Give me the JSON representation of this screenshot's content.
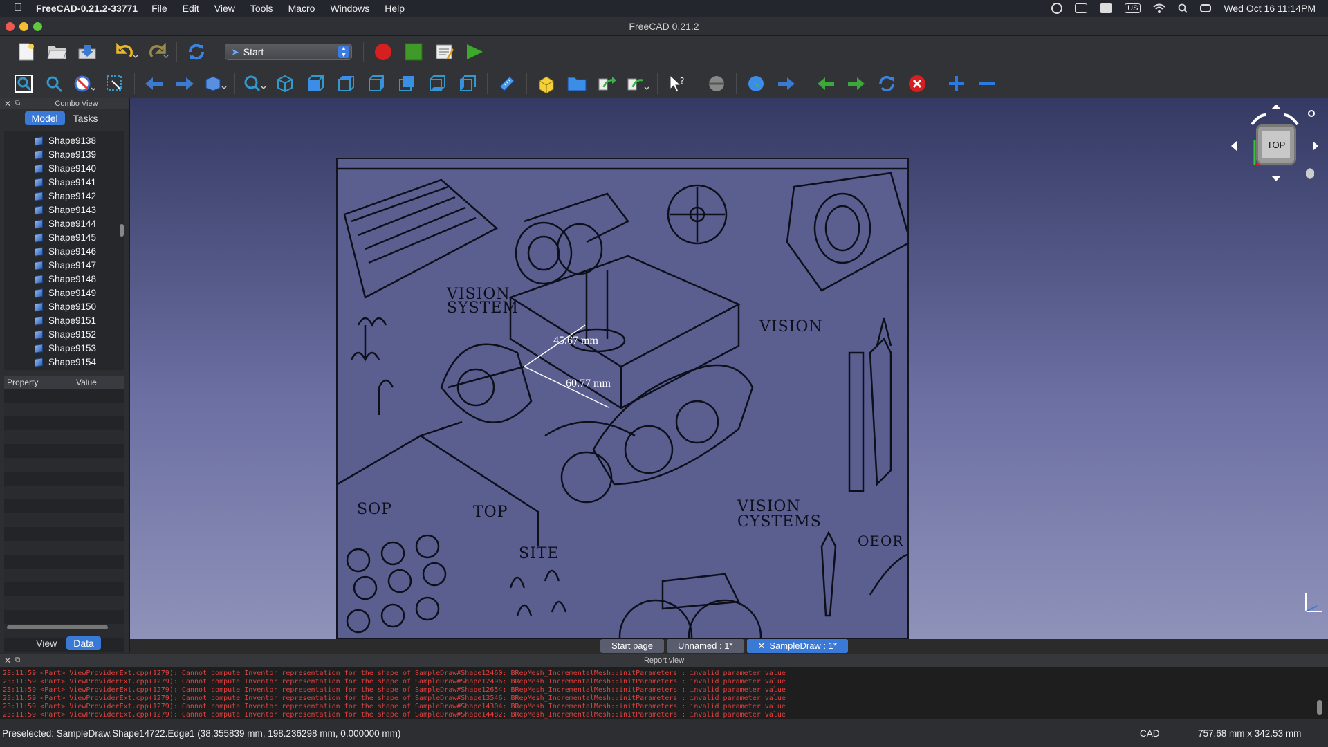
{
  "menubar": {
    "app_name": "FreeCAD-0.21.2-33771",
    "items": [
      "File",
      "Edit",
      "View",
      "Tools",
      "Macro",
      "Windows",
      "Help"
    ],
    "keyboard": "US",
    "clock": "Wed Oct 16  11:14PM"
  },
  "window": {
    "title": "FreeCAD 0.21.2"
  },
  "toolbar": {
    "workbench": "Start"
  },
  "combo": {
    "header": "Combo View",
    "tabs": [
      "Model",
      "Tasks"
    ],
    "tree_items": [
      "Shape9138",
      "Shape9139",
      "Shape9140",
      "Shape9141",
      "Shape9142",
      "Shape9143",
      "Shape9144",
      "Shape9145",
      "Shape9146",
      "Shape9147",
      "Shape9148",
      "Shape9149",
      "Shape9150",
      "Shape9151",
      "Shape9152",
      "Shape9153",
      "Shape9154"
    ],
    "prop_headers": [
      "Property",
      "Value"
    ],
    "bottom_tabs": [
      "View",
      "Data"
    ]
  },
  "viewport": {
    "navcube_face": "TOP",
    "dim1": "45.67 mm",
    "dim2": "60.77 mm",
    "labels": {
      "vision_system": "VISION\nSYSTEM",
      "vision": "VISION",
      "vision_systems": "VISION\nCYSTEMS",
      "sop": "SOP",
      "top": "TOP",
      "site": "SITE",
      "oeor": "OEOR"
    }
  },
  "doc_tabs": [
    "Start page",
    "Unnamed : 1*",
    "SampleDraw : 1*"
  ],
  "report": {
    "header": "Report view",
    "lines": [
      "23:11:59  <Part> ViewProviderExt.cpp(1279): Cannot compute Inventor representation for the shape of SampleDraw#Shape12460: BRepMesh_IncrementalMesh::initParameters : invalid parameter value",
      "23:11:59  <Part> ViewProviderExt.cpp(1279): Cannot compute Inventor representation for the shape of SampleDraw#Shape12496: BRepMesh_IncrementalMesh::initParameters : invalid parameter value",
      "23:11:59  <Part> ViewProviderExt.cpp(1279): Cannot compute Inventor representation for the shape of SampleDraw#Shape12654: BRepMesh_IncrementalMesh::initParameters : invalid parameter value",
      "23:11:59  <Part> ViewProviderExt.cpp(1279): Cannot compute Inventor representation for the shape of SampleDraw#Shape13546: BRepMesh_IncrementalMesh::initParameters : invalid parameter value",
      "23:11:59  <Part> ViewProviderExt.cpp(1279): Cannot compute Inventor representation for the shape of SampleDraw#Shape14304: BRepMesh_IncrementalMesh::initParameters : invalid parameter value",
      "23:11:59  <Part> ViewProviderExt.cpp(1279): Cannot compute Inventor representation for the shape of SampleDraw#Shape14482: BRepMesh_IncrementalMesh::initParameters : invalid parameter value"
    ]
  },
  "status": {
    "preselected": "Preselected: SampleDraw.Shape14722.Edge1 (38.355839 mm, 198.236298 mm, 0.000000 mm)",
    "nav_style": "CAD",
    "dimensions": "757.68 mm x 342.53 mm"
  },
  "colors": {
    "accent": "#3a7ad6",
    "error_text": "#e04040",
    "viewport_top": "#343a63",
    "viewport_bottom": "#8f92b9"
  }
}
